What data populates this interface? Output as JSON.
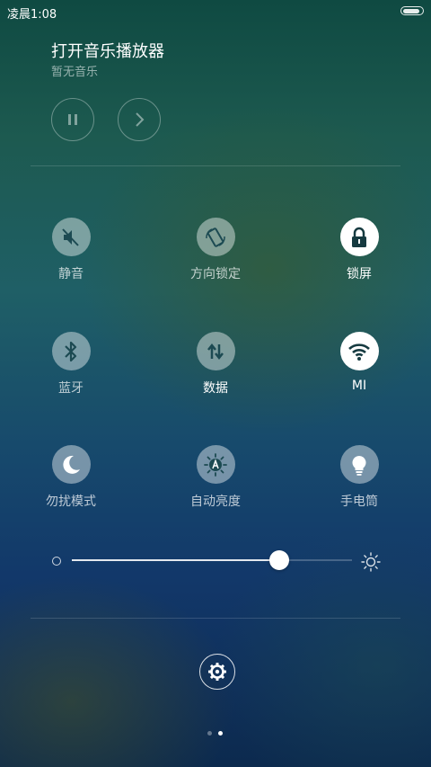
{
  "status_bar": {
    "time": "凌晨1:08",
    "battery_level": 0.9
  },
  "music": {
    "title": "打开音乐播放器",
    "subtitle": "暂无音乐",
    "pause_icon": "pause-icon",
    "next_icon": "chevron-right-icon"
  },
  "toggles": {
    "mute": {
      "label": "静音",
      "icon": "mute-icon",
      "on": false
    },
    "rotation": {
      "label": "方向锁定",
      "icon": "rotation-lock-icon",
      "on": false
    },
    "lock": {
      "label": "锁屏",
      "icon": "lock-icon",
      "on": true
    },
    "bluetooth": {
      "label": "蓝牙",
      "icon": "bluetooth-icon",
      "on": false
    },
    "data": {
      "label": "数据",
      "icon": "mobile-data-icon",
      "on": false
    },
    "wifi": {
      "label": "MI",
      "icon": "wifi-icon",
      "on": true
    },
    "dnd": {
      "label": "勿扰模式",
      "icon": "moon-icon",
      "on": false
    },
    "auto_bright": {
      "label": "自动亮度",
      "icon": "auto-brightness-icon",
      "on": false
    },
    "flashlight": {
      "label": "手电筒",
      "icon": "lightbulb-icon",
      "on": false
    }
  },
  "brightness": {
    "level": 0.74,
    "min_icon": "brightness-low-icon",
    "max_icon": "brightness-high-icon"
  },
  "settings": {
    "icon": "gear-icon"
  },
  "pager": {
    "count": 2,
    "active_index": 1
  },
  "colors": {
    "toggle_off": "rgba(255,255,255,0.42)",
    "toggle_on": "#ffffff",
    "icon_dark": "#1c4a52"
  }
}
